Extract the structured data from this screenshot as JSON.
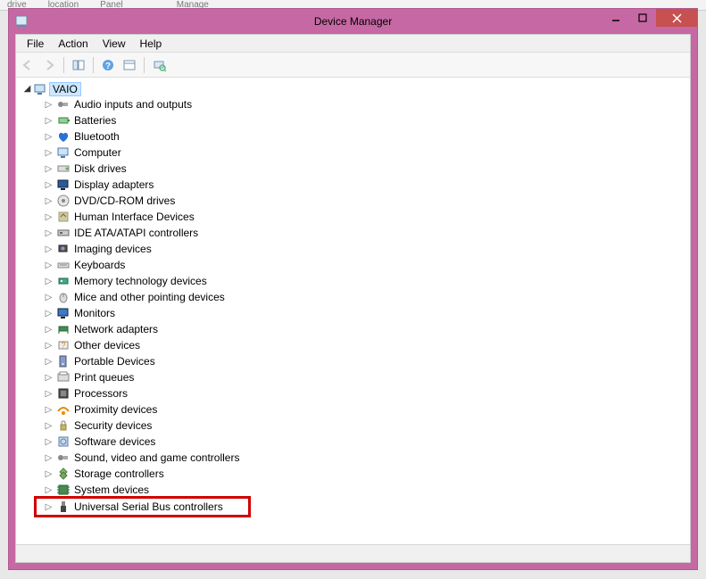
{
  "window": {
    "title": "Device Manager"
  },
  "menu": {
    "file": "File",
    "action": "Action",
    "view": "View",
    "help": "Help"
  },
  "root": {
    "label": "VAIO"
  },
  "devices": [
    {
      "label": "Audio inputs and outputs"
    },
    {
      "label": "Batteries"
    },
    {
      "label": "Bluetooth"
    },
    {
      "label": "Computer"
    },
    {
      "label": "Disk drives"
    },
    {
      "label": "Display adapters"
    },
    {
      "label": "DVD/CD-ROM drives"
    },
    {
      "label": "Human Interface Devices"
    },
    {
      "label": "IDE ATA/ATAPI controllers"
    },
    {
      "label": "Imaging devices"
    },
    {
      "label": "Keyboards"
    },
    {
      "label": "Memory technology devices"
    },
    {
      "label": "Mice and other pointing devices"
    },
    {
      "label": "Monitors"
    },
    {
      "label": "Network adapters"
    },
    {
      "label": "Other devices"
    },
    {
      "label": "Portable Devices"
    },
    {
      "label": "Print queues"
    },
    {
      "label": "Processors"
    },
    {
      "label": "Proximity devices"
    },
    {
      "label": "Security devices"
    },
    {
      "label": "Software devices"
    },
    {
      "label": "Sound, video and game controllers"
    },
    {
      "label": "Storage controllers"
    },
    {
      "label": "System devices"
    }
  ],
  "highlighted": {
    "label": "Universal Serial Bus controllers"
  }
}
